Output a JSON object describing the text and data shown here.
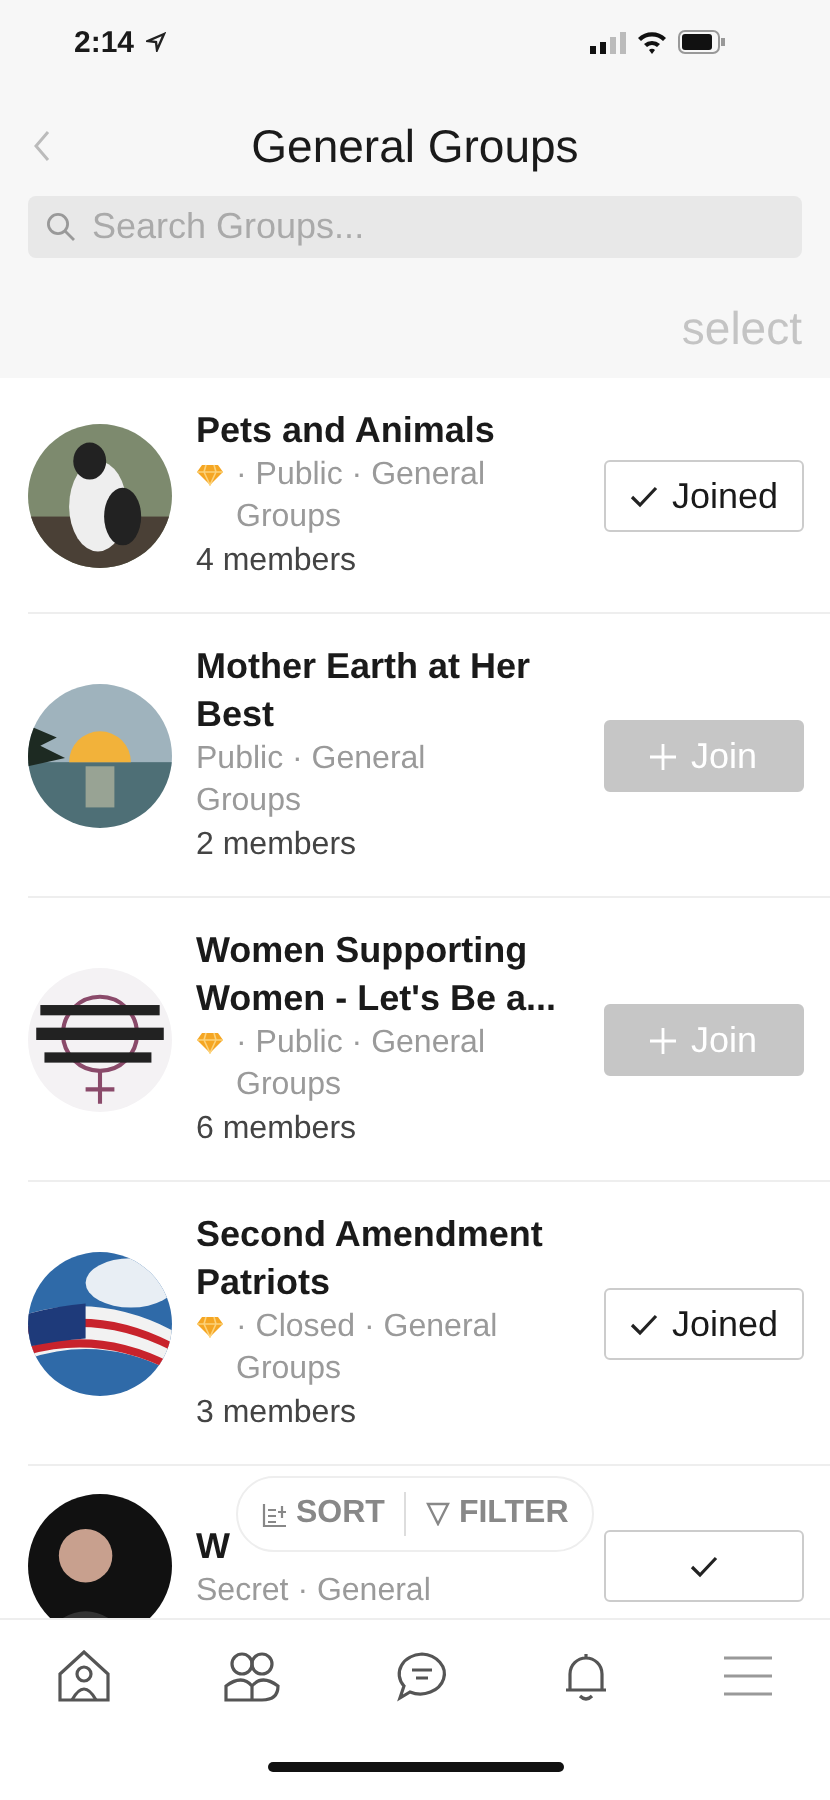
{
  "status_bar": {
    "time": "2:14"
  },
  "header": {
    "title": "General Groups",
    "search": {
      "placeholder": "Search Groups..."
    },
    "select": "select"
  },
  "groups": [
    {
      "name": "Pets and Animals",
      "premium": true,
      "meta": "· Public · General Groups",
      "members": "4 members",
      "joined": true,
      "button": "Joined"
    },
    {
      "name": "Mother Earth at Her Best",
      "premium": false,
      "meta": "Public · General Groups",
      "members": "2 members",
      "joined": false,
      "button": "Join"
    },
    {
      "name": "Women Supporting Women - Let's Be a...",
      "premium": true,
      "meta": "· Public · General Groups",
      "members": "6 members",
      "joined": false,
      "button": "Join"
    },
    {
      "name": "Second Amendment Patriots",
      "premium": true,
      "meta": "· Closed · General Groups",
      "members": "3 members",
      "joined": true,
      "button": "Joined"
    },
    {
      "name": "W",
      "premium": false,
      "meta": "Secret · General",
      "joined": true
    }
  ],
  "sort_filter": {
    "sort": "SORT",
    "filter": "FILTER"
  }
}
